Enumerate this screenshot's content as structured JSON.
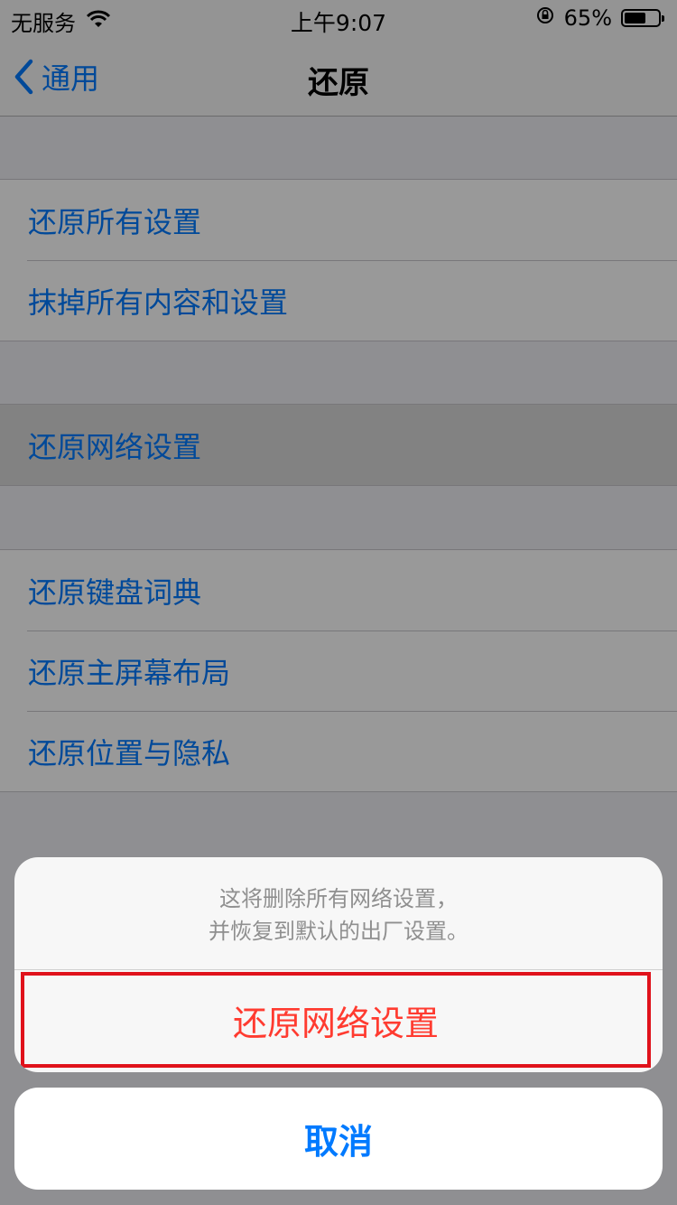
{
  "status_bar": {
    "carrier": "无服务",
    "time": "上午9:07",
    "battery_percent": "65%",
    "battery_level": 0.65,
    "icons": [
      "wifi-icon",
      "rotation-lock-icon",
      "battery-icon"
    ]
  },
  "nav": {
    "back_label": "通用",
    "title": "还原"
  },
  "groups": [
    {
      "items": [
        "还原所有设置",
        "抹掉所有内容和设置"
      ]
    },
    {
      "items": [
        "还原网络设置"
      ]
    },
    {
      "items": [
        "还原键盘词典",
        "还原主屏幕布局",
        "还原位置与隐私"
      ]
    }
  ],
  "action_sheet": {
    "message_line1": "这将删除所有网络设置，",
    "message_line2": "并恢复到默认的出厂设置。",
    "destructive_label": "还原网络设置",
    "cancel_label": "取消"
  },
  "colors": {
    "link_blue": "#007AFF",
    "destructive_red": "#FF3B30",
    "highlight_border": "#E0121B"
  }
}
